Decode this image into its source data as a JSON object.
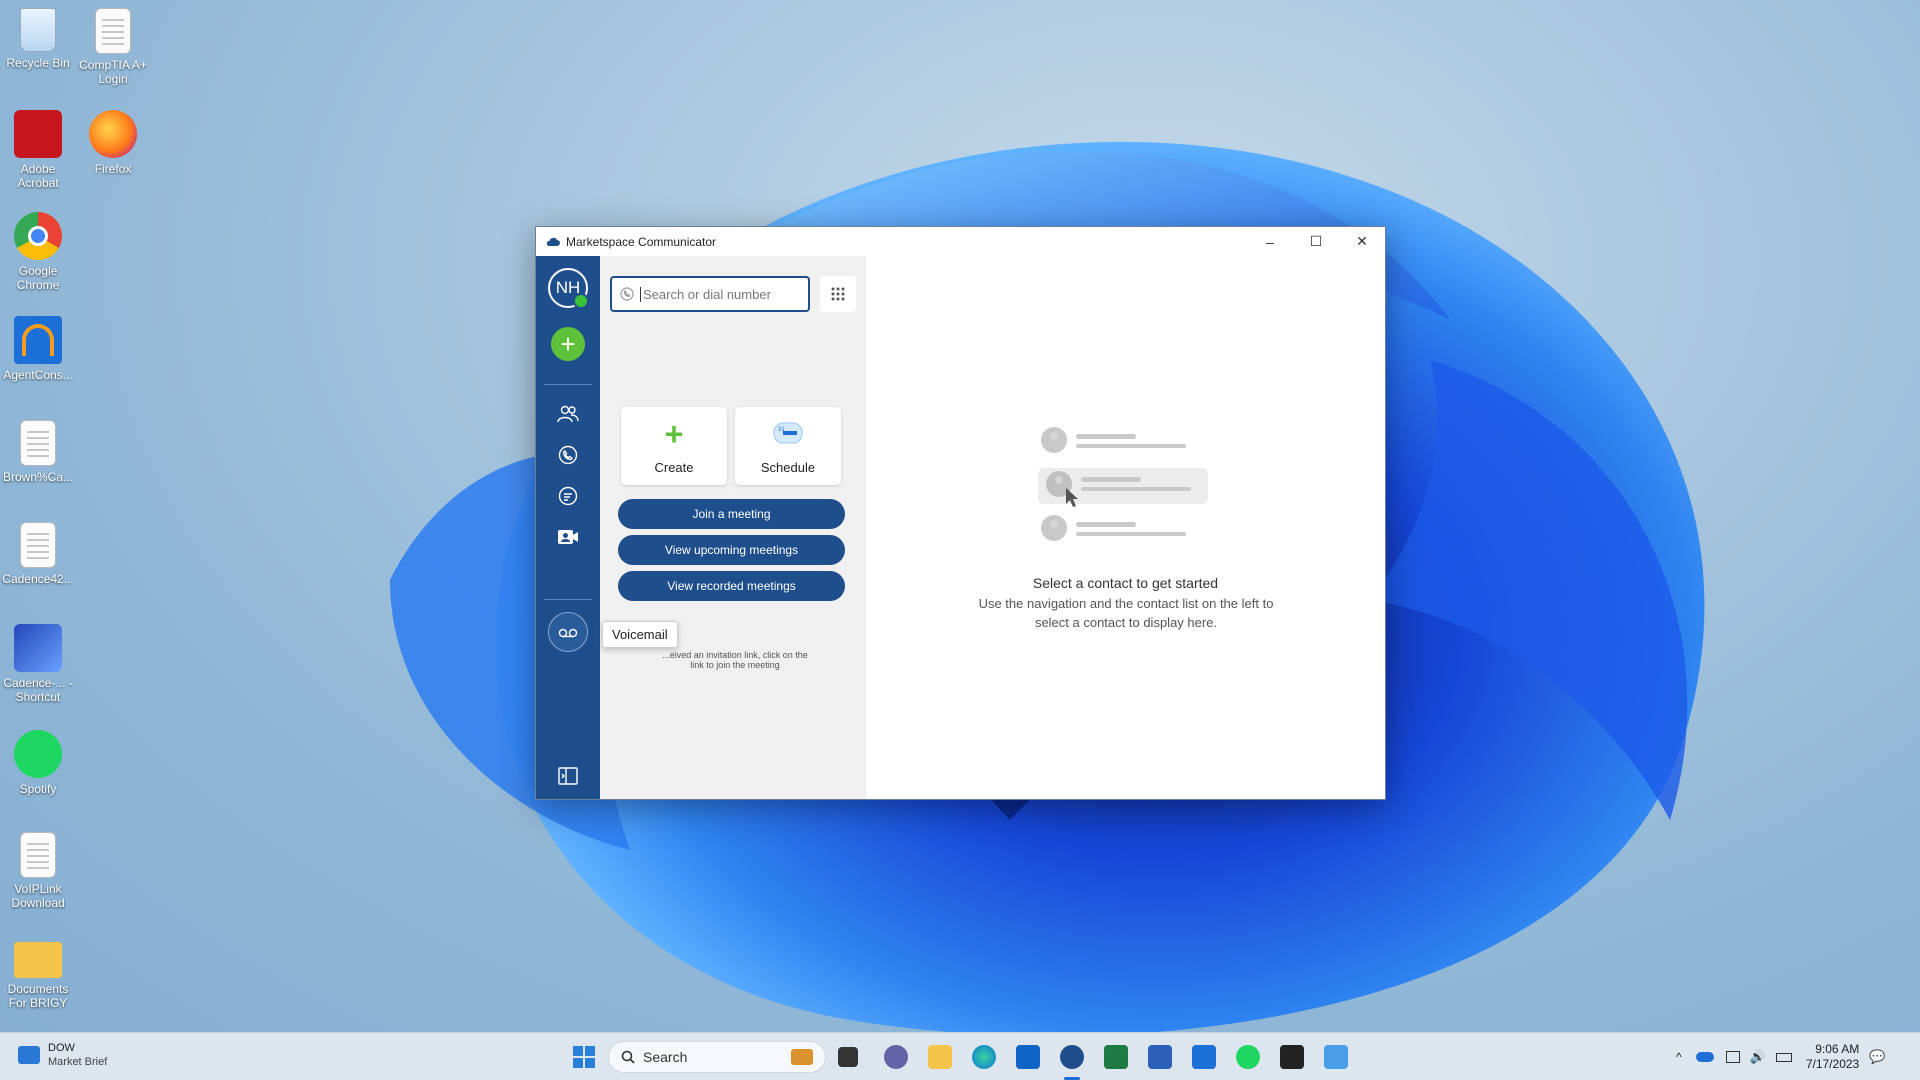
{
  "desktop": {
    "icons": [
      {
        "label": "Recycle Bin"
      },
      {
        "label": "CompTIA A+ Login"
      },
      {
        "label": "Adobe Acrobat"
      },
      {
        "label": "Firefox"
      },
      {
        "label": "Google Chrome"
      },
      {
        "label": "AgentCons..."
      },
      {
        "label": "Brown%Ca..."
      },
      {
        "label": "Cadence42..."
      },
      {
        "label": "Cadence-... - Shortcut"
      },
      {
        "label": "Spotify"
      },
      {
        "label": "VoIPLink Download"
      },
      {
        "label": "Documents For BRIGY"
      }
    ]
  },
  "window": {
    "title": "Marketspace Communicator",
    "minimize": "–",
    "maximize": "☐",
    "close": "✕"
  },
  "rail": {
    "avatar_initials": "NH",
    "add_label": "+",
    "icons": [
      "contacts-icon",
      "phone-icon",
      "chat-icon",
      "meetings-icon",
      "voicemail-icon",
      "sidebar-toggle-icon"
    ]
  },
  "tooltip": {
    "text": "Voicemail"
  },
  "panel": {
    "search_placeholder": "Search or dial number",
    "create_label": "Create",
    "schedule_label": "Schedule",
    "join_label": "Join a meeting",
    "upcoming_label": "View upcoming meetings",
    "recorded_label": "View recorded meetings",
    "hint_line1": "...eived an invitation link, click on the",
    "hint_line2": "link to join the meeting"
  },
  "content": {
    "empty_title": "Select a contact to get started",
    "empty_subtitle_line1": "Use the navigation and the contact list on the left to",
    "empty_subtitle_line2": "select a contact to display here."
  },
  "taskbar": {
    "widget_title": "DOW",
    "widget_subtitle": "Market Brief",
    "search_label": "Search",
    "time": "9:06 AM",
    "date": "7/17/2023",
    "accent": "#1f4e8c"
  }
}
